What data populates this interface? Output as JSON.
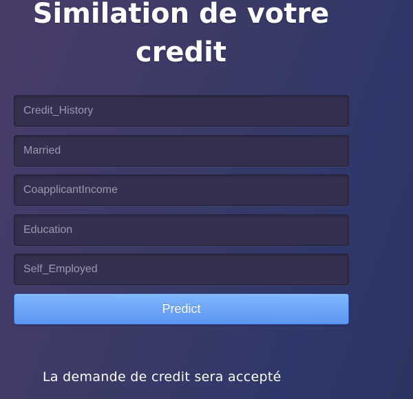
{
  "page": {
    "title": "Similation de votre credit"
  },
  "form": {
    "fields": [
      {
        "placeholder": "Credit_History",
        "value": ""
      },
      {
        "placeholder": "Married",
        "value": ""
      },
      {
        "placeholder": "CoapplicantIncome",
        "value": ""
      },
      {
        "placeholder": "Education",
        "value": ""
      },
      {
        "placeholder": "Self_Employed",
        "value": ""
      }
    ],
    "submit_label": "Predict"
  },
  "result": {
    "text": "La demande de credit sera accepté"
  },
  "colors": {
    "button_top": "#7fb6ff",
    "button_bottom": "#5c95f0",
    "field_background": "#34304f"
  }
}
